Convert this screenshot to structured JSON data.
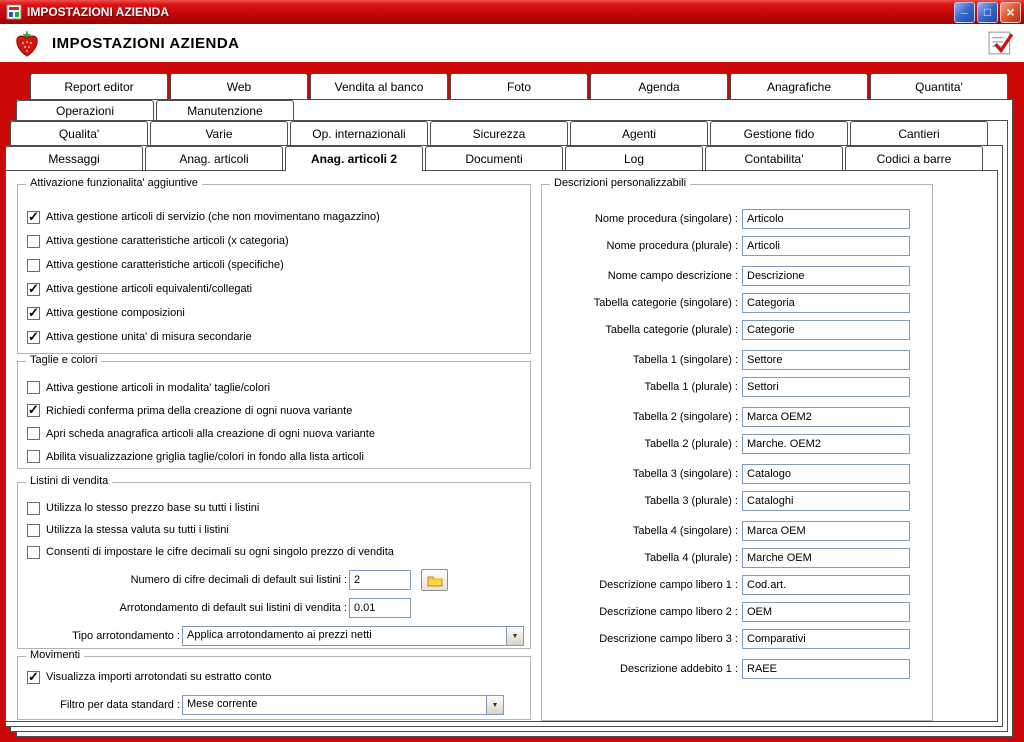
{
  "window": {
    "title": "IMPOSTAZIONI AZIENDA"
  },
  "header": {
    "title": "IMPOSTAZIONI AZIENDA"
  },
  "icons": {
    "minimize": "_",
    "maximize": "□",
    "close": "×",
    "dropdown_arrow": "▼",
    "checkmark": "✓"
  },
  "colors": {
    "frame_red": "#CB0707",
    "titlebar_red": "#C40808",
    "input_border": "#7F9DB9",
    "tab_border": "#4D4D4D"
  },
  "tab_rows": [
    {
      "tabs": [
        {
          "label": "Report editor"
        },
        {
          "label": "Web"
        },
        {
          "label": "Vendita al banco"
        },
        {
          "label": "Foto"
        },
        {
          "label": "Agenda"
        },
        {
          "label": "Anagrafiche"
        },
        {
          "label": "Quantita'"
        }
      ]
    },
    {
      "tabs": [
        {
          "label": "Operazioni"
        },
        {
          "label": "Manutenzione"
        }
      ]
    },
    {
      "tabs": [
        {
          "label": "Qualita'"
        },
        {
          "label": "Varie"
        },
        {
          "label": "Op. internazionali"
        },
        {
          "label": "Sicurezza"
        },
        {
          "label": "Agenti"
        },
        {
          "label": "Gestione fido"
        },
        {
          "label": "Cantieri"
        }
      ]
    },
    {
      "tabs": [
        {
          "label": "Messaggi"
        },
        {
          "label": "Anag. articoli"
        },
        {
          "label": "Anag. articoli 2",
          "selected": true
        },
        {
          "label": "Documenti"
        },
        {
          "label": "Log"
        },
        {
          "label": "Contabilita'"
        },
        {
          "label": "Codici a barre"
        }
      ]
    }
  ],
  "groups": {
    "attivazione": {
      "title": "Attivazione funzionalita' aggiuntive",
      "checkboxes": [
        {
          "label": "Attiva gestione articoli di servizio (che non movimentano magazzino)",
          "checked": true
        },
        {
          "label": "Attiva gestione caratteristiche articoli (x categoria)",
          "checked": false
        },
        {
          "label": "Attiva gestione caratteristiche articoli (specifiche)",
          "checked": false
        },
        {
          "label": "Attiva gestione articoli equivalenti/collegati",
          "checked": true
        },
        {
          "label": "Attiva gestione composizioni",
          "checked": true
        },
        {
          "label": "Attiva gestione unita' di misura secondarie",
          "checked": true
        }
      ]
    },
    "taglie": {
      "title": "Taglie e colori",
      "checkboxes": [
        {
          "label": "Attiva gestione articoli in modalita' taglie/colori",
          "checked": false
        },
        {
          "label": "Richiedi conferma prima della creazione di ogni nuova variante",
          "checked": true
        },
        {
          "label": "Apri scheda anagrafica articoli alla creazione di ogni nuova variante",
          "checked": false
        },
        {
          "label": "Abilita visualizzazione griglia taglie/colori in fondo alla lista articoli",
          "checked": false
        }
      ]
    },
    "listini": {
      "title": "Listini di vendita",
      "checkboxes": [
        {
          "label": "Utilizza lo stesso prezzo base su tutti i listini",
          "checked": false
        },
        {
          "label": "Utilizza la stessa valuta su tutti i listini",
          "checked": false
        },
        {
          "label": "Consenti di impostare le cifre decimali su ogni singolo prezzo di vendita",
          "checked": false
        }
      ],
      "fields": {
        "decimali": {
          "label": "Numero di cifre decimali di default sui listini :",
          "value": "2"
        },
        "arrotondamento": {
          "label": "Arrotondamento di default sui listini di vendita :",
          "value": "0.01"
        },
        "tipo": {
          "label": "Tipo arrotondamento :",
          "value": "Applica arrotondamento ai prezzi netti"
        }
      }
    },
    "movimenti": {
      "title": "Movimenti",
      "checkboxes": [
        {
          "label": "Visualizza importi arrotondati su estratto conto",
          "checked": true
        }
      ],
      "fields": {
        "filtro": {
          "label": "Filtro per data standard :",
          "value": "Mese corrente"
        }
      }
    },
    "descrizioni": {
      "title": "Descrizioni personalizzabili",
      "fields": [
        {
          "label": "Nome procedura (singolare) :",
          "value": "Articolo"
        },
        {
          "label": "Nome procedura (plurale) :",
          "value": "Articoli"
        },
        {
          "label": "Nome campo descrizione :",
          "value": "Descrizione",
          "gap": true
        },
        {
          "label": "Tabella categorie (singolare) :",
          "value": "Categoria"
        },
        {
          "label": "Tabella categorie (plurale) :",
          "value": "Categorie"
        },
        {
          "label": "Tabella 1 (singolare) :",
          "value": "Settore",
          "gap": true
        },
        {
          "label": "Tabella 1 (plurale) :",
          "value": "Settori"
        },
        {
          "label": "Tabella 2 (singolare) :",
          "value": "Marca OEM2",
          "gap": true
        },
        {
          "label": "Tabella 2 (plurale) :",
          "value": "Marche. OEM2"
        },
        {
          "label": "Tabella 3 (singolare) :",
          "value": "Catalogo",
          "gap": true
        },
        {
          "label": "Tabella 3 (plurale) :",
          "value": "Cataloghi"
        },
        {
          "label": "Tabella 4 (singolare) :",
          "value": "Marca OEM",
          "gap": true
        },
        {
          "label": "Tabella 4 (plurale) :",
          "value": "Marche OEM"
        },
        {
          "label": "Descrizione campo libero 1 :",
          "value": "Cod.art."
        },
        {
          "label": "Descrizione campo libero 2 :",
          "value": "OEM"
        },
        {
          "label": "Descrizione campo libero 3 :",
          "value": "Comparativi"
        },
        {
          "label": "Descrizione addebito 1 :",
          "value": "RAEE",
          "gap": true
        }
      ]
    }
  }
}
